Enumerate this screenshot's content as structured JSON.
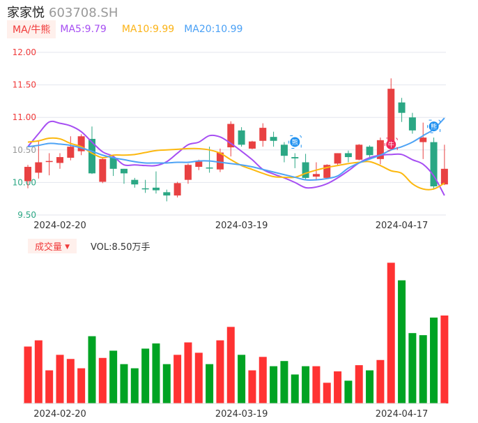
{
  "header": {
    "name": "家家悦",
    "code": "603708.SH"
  },
  "legend": {
    "tag": "MA/牛熊",
    "ma5": "MA5:9.79",
    "ma10": "MA10:9.99",
    "ma20": "MA20:10.99"
  },
  "volume_panel": {
    "tag": "成交量",
    "arrow": "▼",
    "label": "VOL:8.50万手"
  },
  "colors": {
    "up": "#e84142",
    "down": "#2ba784",
    "vol_up": "#ff3232",
    "vol_down": "#00a323",
    "ma5": "#a64ef2",
    "ma10": "#fcb80f",
    "ma20": "#4ea3f5",
    "axis_up": "#f03a3a",
    "axis_mid": "#999999",
    "axis_down": "#2ba784"
  },
  "chart_data": [
    {
      "type": "candlestick",
      "title": "家家悦 603708.SH",
      "ylim": [
        9.5,
        12.0
      ],
      "yticks": [
        "12.00",
        "11.50",
        "11.00",
        "10.50",
        "10.00",
        "9.50"
      ],
      "xtick_labels": [
        {
          "index": 3,
          "label": "2024-02-20"
        },
        {
          "index": 20,
          "label": "2024-03-19"
        },
        {
          "index": 35,
          "label": "2024-04-17"
        }
      ],
      "ohlc": [
        [
          10.02,
          10.27,
          9.91,
          10.24
        ],
        [
          10.15,
          10.64,
          10.06,
          10.31
        ],
        [
          10.32,
          10.45,
          10.11,
          10.33
        ],
        [
          10.3,
          10.45,
          10.21,
          10.39
        ],
        [
          10.38,
          10.71,
          10.34,
          10.55
        ],
        [
          10.48,
          10.74,
          10.42,
          10.71
        ],
        [
          10.67,
          10.86,
          10.13,
          10.14
        ],
        [
          10.01,
          10.38,
          9.99,
          10.36
        ],
        [
          10.38,
          10.41,
          10.1,
          10.21
        ],
        [
          10.21,
          10.21,
          9.98,
          10.14
        ],
        [
          10.04,
          10.07,
          9.92,
          9.97
        ],
        [
          9.91,
          10.04,
          9.84,
          9.9
        ],
        [
          9.92,
          10.17,
          9.83,
          9.88
        ],
        [
          9.85,
          9.89,
          9.71,
          9.8
        ],
        [
          9.8,
          10.01,
          9.77,
          9.99
        ],
        [
          10.04,
          10.29,
          9.98,
          10.27
        ],
        [
          10.24,
          10.35,
          10.19,
          10.32
        ],
        [
          10.23,
          10.55,
          10.15,
          10.22
        ],
        [
          10.2,
          10.52,
          10.16,
          10.46
        ],
        [
          10.54,
          10.94,
          10.4,
          10.9
        ],
        [
          10.8,
          10.85,
          10.55,
          10.58
        ],
        [
          10.52,
          10.64,
          10.51,
          10.63
        ],
        [
          10.64,
          10.91,
          10.55,
          10.84
        ],
        [
          10.7,
          10.78,
          10.55,
          10.64
        ],
        [
          10.58,
          10.62,
          10.31,
          10.41
        ],
        [
          10.39,
          10.45,
          10.22,
          10.37
        ],
        [
          10.31,
          10.44,
          10.05,
          10.07
        ],
        [
          10.09,
          10.31,
          10.03,
          10.13
        ],
        [
          10.07,
          10.28,
          10.06,
          10.27
        ],
        [
          10.29,
          10.45,
          10.27,
          10.45
        ],
        [
          10.45,
          10.49,
          10.31,
          10.39
        ],
        [
          10.35,
          10.59,
          10.34,
          10.58
        ],
        [
          10.55,
          10.57,
          10.39,
          10.42
        ],
        [
          10.36,
          10.69,
          10.28,
          10.65
        ],
        [
          10.56,
          11.6,
          10.52,
          11.44
        ],
        [
          11.23,
          11.3,
          10.93,
          11.07
        ],
        [
          11.0,
          11.07,
          10.75,
          10.8
        ],
        [
          10.62,
          10.92,
          10.36,
          10.69
        ],
        [
          10.62,
          10.69,
          9.89,
          9.94
        ],
        [
          9.97,
          10.58,
          9.96,
          10.21
        ]
      ],
      "series": [
        {
          "name": "MA5",
          "values": [
            10.55,
            10.75,
            10.93,
            10.91,
            10.87,
            10.78,
            10.62,
            10.47,
            10.4,
            10.27,
            10.27,
            10.26,
            10.26,
            10.32,
            10.45,
            10.58,
            10.62,
            10.72,
            10.7,
            10.6,
            10.48,
            10.35,
            10.2,
            10.13,
            10.07,
            10.0,
            9.92,
            9.93,
            9.98,
            10.07,
            10.18,
            10.3,
            10.38,
            10.42,
            10.43,
            10.43,
            10.35,
            10.28,
            10.1,
            9.8
          ]
        },
        {
          "name": "MA10",
          "values": [
            10.62,
            10.64,
            10.68,
            10.67,
            10.6,
            10.55,
            10.45,
            10.38,
            10.42,
            10.42,
            10.43,
            10.46,
            10.49,
            10.5,
            10.51,
            10.52,
            10.52,
            10.5,
            10.45,
            10.35,
            10.26,
            10.2,
            10.14,
            10.09,
            10.08,
            10.08,
            10.14,
            10.19,
            10.23,
            10.26,
            10.29,
            10.31,
            10.32,
            10.26,
            10.18,
            10.14,
            9.98,
            9.9,
            9.9,
            9.99
          ]
        },
        {
          "name": "MA20",
          "values": [
            10.55,
            10.57,
            10.6,
            10.59,
            10.57,
            10.53,
            10.48,
            10.42,
            10.38,
            10.35,
            10.32,
            10.3,
            10.3,
            10.3,
            10.31,
            10.31,
            10.33,
            10.33,
            10.31,
            10.29,
            10.27,
            10.24,
            10.2,
            10.16,
            10.12,
            10.08,
            10.04,
            10.04,
            10.06,
            10.1,
            10.22,
            10.3,
            10.36,
            10.42,
            10.5,
            10.55,
            10.62,
            10.72,
            10.82,
            10.99
          ]
        }
      ],
      "signals": [
        {
          "index": 25,
          "type": "bear",
          "label": "熊"
        },
        {
          "index": 34,
          "type": "bull",
          "label": "牛"
        },
        {
          "index": 38,
          "type": "bear",
          "label": "熊"
        }
      ]
    },
    {
      "type": "bar",
      "title": "成交量",
      "unit": "万手",
      "values": [
        5.5,
        6.1,
        3.2,
        4.7,
        4.3,
        3.4,
        6.5,
        4.4,
        5.1,
        3.8,
        3.4,
        5.3,
        5.8,
        3.8,
        4.7,
        5.9,
        4.9,
        3.8,
        6.1,
        7.4,
        4.7,
        3.2,
        4.5,
        3.6,
        4.1,
        2.8,
        3.6,
        3.6,
        2.0,
        3.1,
        2.2,
        3.7,
        3.2,
        4.2,
        13.6,
        11.9,
        6.8,
        6.6,
        8.3,
        8.5
      ],
      "up": [
        1,
        1,
        1,
        1,
        1,
        1,
        0,
        1,
        0,
        0,
        0,
        0,
        0,
        0,
        1,
        1,
        1,
        0,
        1,
        1,
        0,
        1,
        1,
        0,
        0,
        0,
        0,
        1,
        1,
        1,
        0,
        1,
        0,
        1,
        1,
        0,
        0,
        0,
        0,
        1
      ],
      "xtick_labels": [
        {
          "index": 3,
          "label": "2024-02-20"
        },
        {
          "index": 20,
          "label": "2024-03-19"
        },
        {
          "index": 35,
          "label": "2024-04-17"
        }
      ]
    }
  ]
}
